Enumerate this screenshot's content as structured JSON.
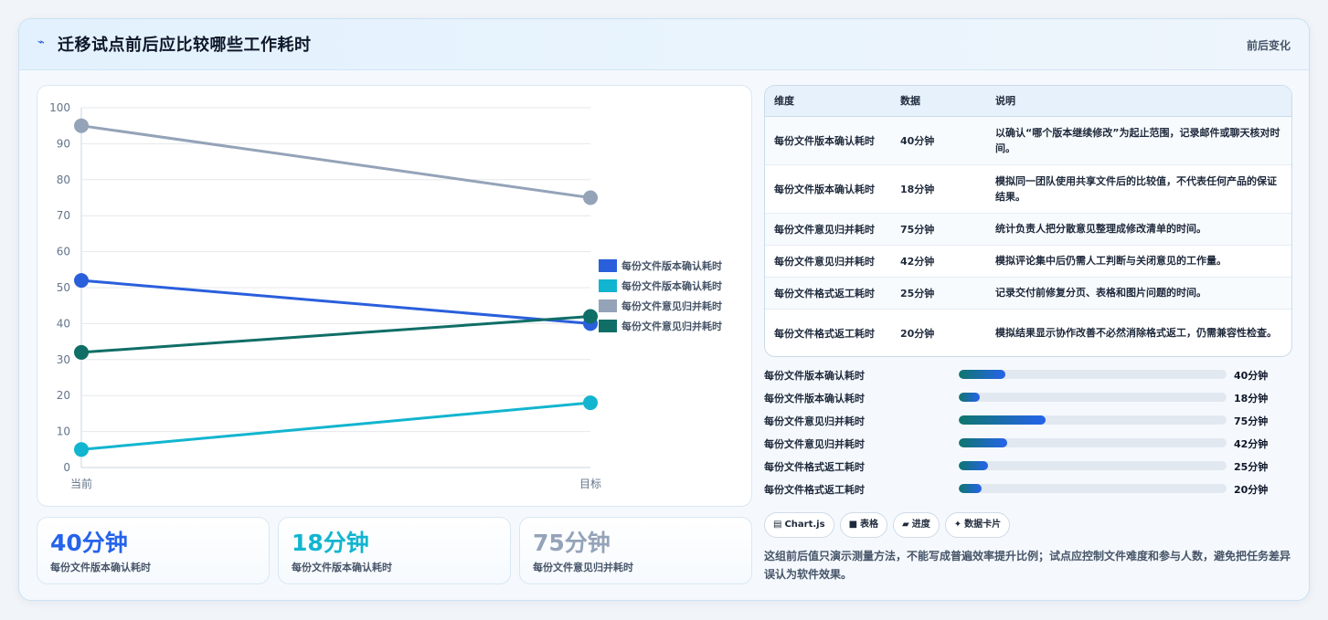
{
  "header": {
    "title_icon": "wave-icon",
    "title": "迁移试点前后应比较哪些工作耗时",
    "tag": "前后变化"
  },
  "chart_data": {
    "type": "line",
    "x": [
      "当前",
      "目标"
    ],
    "ylim": [
      0,
      100
    ],
    "yticks": [
      0,
      10,
      20,
      30,
      40,
      50,
      60,
      70,
      80,
      90,
      100
    ],
    "grid": true,
    "legend_position": "right",
    "series": [
      {
        "name": "每份文件版本确认耗时",
        "values": [
          52,
          40
        ],
        "color": "#2a5fdc"
      },
      {
        "name": "每份文件版本确认耗时",
        "values": [
          5,
          18
        ],
        "color": "#12b5cf"
      },
      {
        "name": "每份文件意见归并耗时",
        "values": [
          95,
          75
        ],
        "color": "#94a3b8"
      },
      {
        "name": "每份文件意见归并耗时",
        "values": [
          32,
          42
        ],
        "color": "#0f6e66"
      }
    ]
  },
  "stats": [
    {
      "value": "40分钟",
      "label": "每份文件版本确认耗时",
      "color": "#2563eb"
    },
    {
      "value": "18分钟",
      "label": "每份文件版本确认耗时",
      "color": "#12b5cf"
    },
    {
      "value": "75分钟",
      "label": "每份文件意见归并耗时",
      "color": "#94a3b8"
    }
  ],
  "table": {
    "headers": [
      "维度",
      "数据",
      "说明"
    ],
    "rows": [
      {
        "dim": "每份文件版本确认耗时",
        "val": "40分钟",
        "desc": "以确认“哪个版本继续修改”为起止范围，记录邮件或聊天核对时间。"
      },
      {
        "dim": "每份文件版本确认耗时",
        "val": "18分钟",
        "desc": "模拟同一团队使用共享文件后的比较值，不代表任何产品的保证结果。"
      },
      {
        "dim": "每份文件意见归并耗时",
        "val": "75分钟",
        "desc": "统计负责人把分散意见整理成修改清单的时间。"
      },
      {
        "dim": "每份文件意见归并耗时",
        "val": "42分钟",
        "desc": "模拟评论集中后仍需人工判断与关闭意见的工作量。"
      },
      {
        "dim": "每份文件格式返工耗时",
        "val": "25分钟",
        "desc": "记录交付前修复分页、表格和图片问题的时间。"
      },
      {
        "dim": "每份文件格式返工耗时",
        "val": "20分钟",
        "desc": "模拟结果显示协作改善不必然消除格式返工，仍需兼容性检查。"
      }
    ]
  },
  "bars": [
    {
      "label": "每份文件版本确认耗时",
      "value": "40分钟",
      "percent": 17.5
    },
    {
      "label": "每份文件版本确认耗时",
      "value": "18分钟",
      "percent": 8
    },
    {
      "label": "每份文件意见归并耗时",
      "value": "75分钟",
      "percent": 32.5
    },
    {
      "label": "每份文件意见归并耗时",
      "value": "42分钟",
      "percent": 18
    },
    {
      "label": "每份文件格式返工耗时",
      "value": "25分钟",
      "percent": 11
    },
    {
      "label": "每份文件格式返工耗时",
      "value": "20分钟",
      "percent": 8.5
    }
  ],
  "chips": [
    {
      "icon": "▤",
      "icon_name": "chart-icon",
      "label": "Chart.js"
    },
    {
      "icon": "■",
      "icon_name": "table-icon",
      "label": "表格"
    },
    {
      "icon": "▰",
      "icon_name": "progress-icon",
      "label": "进度"
    },
    {
      "icon": "✦",
      "icon_name": "sparkle-icon",
      "label": "数据卡片"
    }
  ],
  "note": "这组前后值只演示测量方法，不能写成普遍效率提升比例；试点应控制文件难度和参与人数，避免把任务差异误认为软件效果。"
}
